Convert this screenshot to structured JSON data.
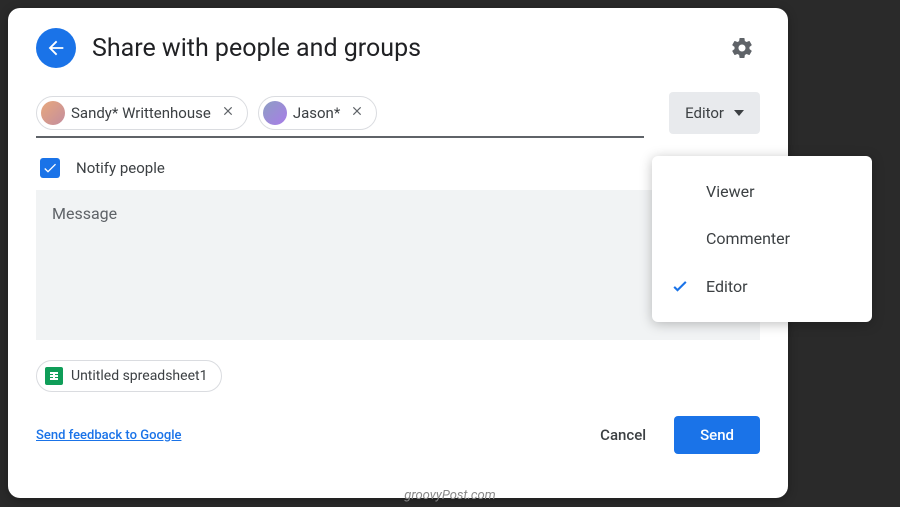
{
  "header": {
    "title": "Share with people and groups"
  },
  "people": [
    {
      "name": "Sandy* Writtenhouse"
    },
    {
      "name": "Jason*"
    }
  ],
  "role_selected": "Editor",
  "notify": {
    "label": "Notify people",
    "checked": true
  },
  "message_placeholder": "Message",
  "attachment": {
    "name": "Untitled spreadsheet1"
  },
  "footer": {
    "feedback": "Send feedback to Google",
    "cancel": "Cancel",
    "send": "Send"
  },
  "dropdown": {
    "options": [
      "Viewer",
      "Commenter",
      "Editor"
    ],
    "selected_index": 2
  },
  "watermark": "groovyPost.com"
}
